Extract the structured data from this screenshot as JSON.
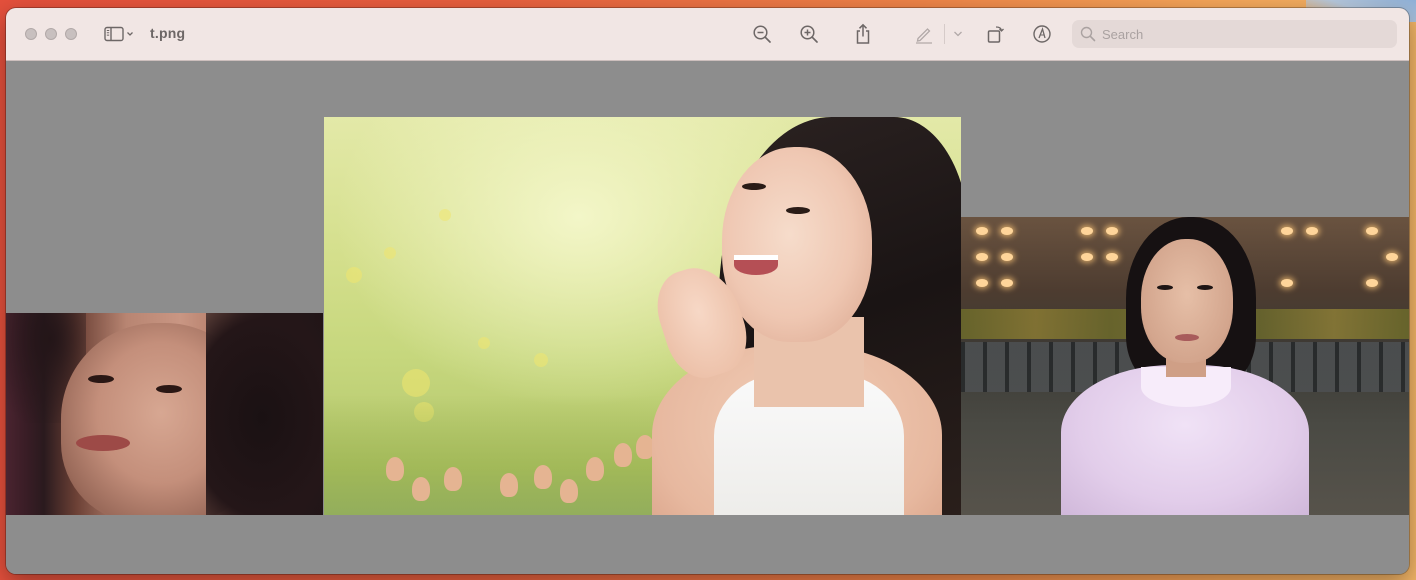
{
  "window": {
    "title": "t.png"
  },
  "toolbar": {
    "buttons": [
      {
        "name": "sidebar",
        "icon": "sidebar-icon"
      },
      {
        "name": "zoom-out",
        "icon": "zoom-out-icon"
      },
      {
        "name": "zoom-in",
        "icon": "zoom-in-icon"
      },
      {
        "name": "share",
        "icon": "share-icon"
      },
      {
        "name": "markup",
        "icon": "pen-icon"
      },
      {
        "name": "markup-options",
        "icon": "chevron-down-icon"
      },
      {
        "name": "rotate",
        "icon": "rotate-icon"
      },
      {
        "name": "annotate",
        "icon": "annotate-circle-icon"
      }
    ],
    "search_placeholder": "Search",
    "search_value": ""
  },
  "document": {
    "photos": [
      {
        "name": "close-up-portrait",
        "description_hidden": true
      },
      {
        "name": "spring-portrait"
      },
      {
        "name": "street-portrait"
      }
    ]
  },
  "colors": {
    "titlebar": "#f1e6e4",
    "canvas": "#8d8d8d",
    "icon": "#6d6766",
    "search_bg": "#e4d9d7"
  }
}
